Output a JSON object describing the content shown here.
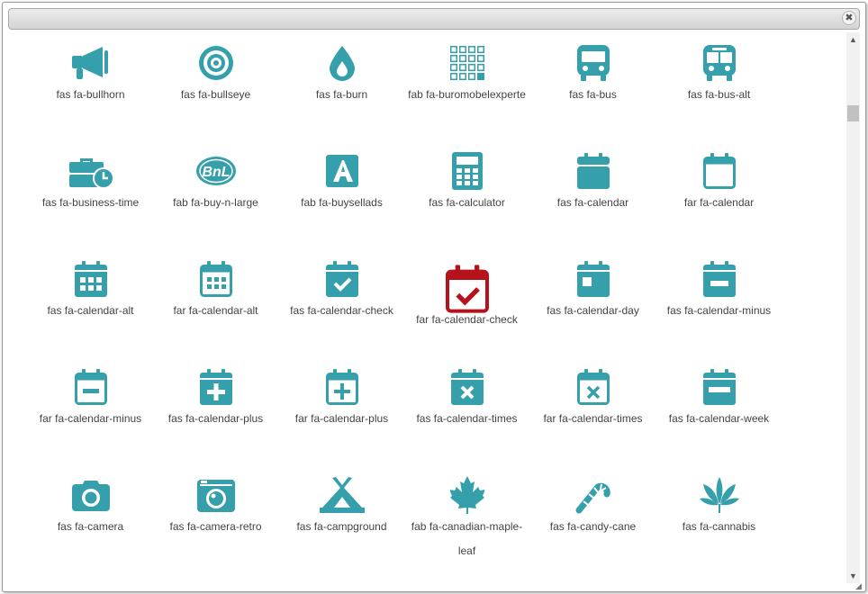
{
  "dialog": {
    "close_glyph": "✖",
    "accent_color": "#35a0ab",
    "selected_color": "#b5121b"
  },
  "scrollbar": {
    "up_glyph": "▲",
    "down_glyph": "▼"
  },
  "icons": [
    {
      "label": "fas fa-bullhorn",
      "icon": "bullhorn-icon"
    },
    {
      "label": "fas fa-bullseye",
      "icon": "bullseye-icon"
    },
    {
      "label": "fas fa-burn",
      "icon": "burn-icon"
    },
    {
      "label": "fab fa-buromobelexperte",
      "icon": "buromobelexperte-icon"
    },
    {
      "label": "fas fa-bus",
      "icon": "bus-icon"
    },
    {
      "label": "fas fa-bus-alt",
      "icon": "bus-alt-icon"
    },
    {
      "label": "fas fa-business-time",
      "icon": "business-time-icon"
    },
    {
      "label": "fab fa-buy-n-large",
      "icon": "buy-n-large-icon"
    },
    {
      "label": "fab fa-buysellads",
      "icon": "buysellads-icon"
    },
    {
      "label": "fas fa-calculator",
      "icon": "calculator-icon"
    },
    {
      "label": "fas fa-calendar",
      "icon": "calendar-icon"
    },
    {
      "label": "far fa-calendar",
      "icon": "calendar-outline-icon"
    },
    {
      "label": "fas fa-calendar-alt",
      "icon": "calendar-alt-icon"
    },
    {
      "label": "far fa-calendar-alt",
      "icon": "calendar-alt-outline-icon"
    },
    {
      "label": "fas fa-calendar-check",
      "icon": "calendar-check-icon"
    },
    {
      "label": "far fa-calendar-check",
      "icon": "calendar-check-outline-icon",
      "selected": true
    },
    {
      "label": "fas fa-calendar-day",
      "icon": "calendar-day-icon"
    },
    {
      "label": "fas fa-calendar-minus",
      "icon": "calendar-minus-icon"
    },
    {
      "label": "far fa-calendar-minus",
      "icon": "calendar-minus-outline-icon"
    },
    {
      "label": "fas fa-calendar-plus",
      "icon": "calendar-plus-icon"
    },
    {
      "label": "far fa-calendar-plus",
      "icon": "calendar-plus-outline-icon"
    },
    {
      "label": "fas fa-calendar-times",
      "icon": "calendar-times-icon"
    },
    {
      "label": "far fa-calendar-times",
      "icon": "calendar-times-outline-icon"
    },
    {
      "label": "fas fa-calendar-week",
      "icon": "calendar-week-icon"
    },
    {
      "label": "fas fa-camera",
      "icon": "camera-icon"
    },
    {
      "label": "fas fa-camera-retro",
      "icon": "camera-retro-icon"
    },
    {
      "label": "fas fa-campground",
      "icon": "campground-icon"
    },
    {
      "label": "fab fa-canadian-maple-leaf",
      "icon": "canadian-maple-leaf-icon"
    },
    {
      "label": "fas fa-candy-cane",
      "icon": "candy-cane-icon"
    },
    {
      "label": "fas fa-cannabis",
      "icon": "cannabis-icon"
    }
  ]
}
